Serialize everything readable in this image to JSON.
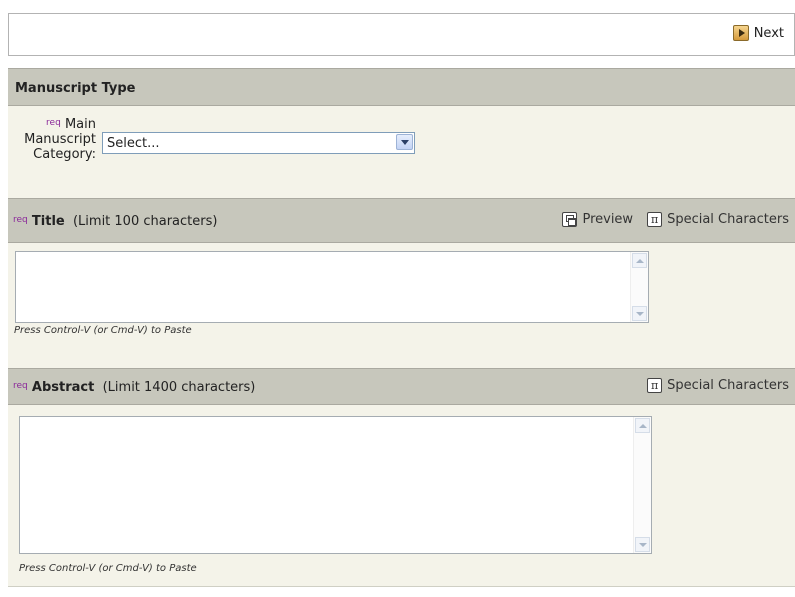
{
  "nav": {
    "next_label": "Next"
  },
  "manuscript_type": {
    "header": "Manuscript Type",
    "category": {
      "req": "req",
      "label_line1": "Main",
      "label_line2": "Manuscript",
      "label_line3": "Category:",
      "selected": "Select..."
    }
  },
  "title_section": {
    "req": "req",
    "label": "Title",
    "limit": "(Limit 100 characters)",
    "preview_label": "Preview",
    "special_chars_label": "Special Characters",
    "hint": "Press Control-V (or Cmd-V) to Paste"
  },
  "abstract_section": {
    "req": "req",
    "label": "Abstract",
    "limit": "(Limit 1400 characters)",
    "special_chars_label": "Special Characters",
    "hint": "Press Control-V (or Cmd-V) to Paste"
  },
  "icons": {
    "next": "play-arrow-icon",
    "preview": "window-icon",
    "special_chars": "pi-icon"
  }
}
